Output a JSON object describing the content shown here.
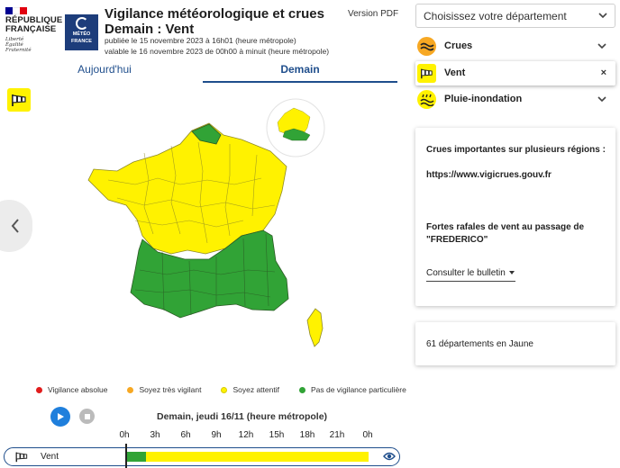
{
  "header": {
    "republique_line1": "RÉPUBLIQUE",
    "republique_line2": "FRANÇAISE",
    "motto": [
      "Liberté",
      "Égalité",
      "Fraternité"
    ],
    "meteo_logo_text": [
      "MÉTÉO",
      "FRANCE"
    ],
    "title_line1": "Vigilance météorologique et crues",
    "title_line2": "Demain : Vent",
    "published": "publiée le 15 novembre 2023 à 16h01 (heure métropole)",
    "valid": "valable le 16 novembre 2023 de 00h00 à minuit (heure métropole)",
    "pdf_link": "Version PDF"
  },
  "tabs": [
    {
      "label": "Aujourd'hui",
      "active": false
    },
    {
      "label": "Demain",
      "active": true
    }
  ],
  "legend": [
    {
      "label": "Vigilance absolue",
      "color": "#e11d1d"
    },
    {
      "label": "Soyez très vigilant",
      "color": "#f7a823"
    },
    {
      "label": "Soyez attentif",
      "color": "#fff200"
    },
    {
      "label": "Pas de vigilance particulière",
      "color": "#31a336"
    }
  ],
  "timeline": {
    "date_label": "Demain, jeudi 16/11 (heure métropole)",
    "hours": [
      "0h",
      "3h",
      "6h",
      "9h",
      "12h",
      "15h",
      "18h",
      "21h",
      "0h"
    ],
    "row_label": "Vent",
    "segments": [
      {
        "from_hour": 0,
        "to_hour": 2,
        "level_color": "#31a336"
      },
      {
        "from_hour": 2,
        "to_hour": 24,
        "level_color": "#fff200"
      }
    ]
  },
  "right_panel": {
    "department_select": "Choisissez votre département",
    "phenomena": [
      {
        "label": "Crues",
        "icon": "waves-icon",
        "color": "#f7a823",
        "action": "chevron-down",
        "selected": false
      },
      {
        "label": "Vent",
        "icon": "windsock-icon",
        "color": "#fff200",
        "action": "×",
        "selected": true
      },
      {
        "label": "Pluie-inondation",
        "icon": "rain-flood-icon",
        "color": "#fff200",
        "action": "chevron-down",
        "selected": false
      }
    ],
    "info_card": {
      "line1": "Crues importantes sur plusieurs régions :",
      "line2": "https://www.vigicrues.gouv.fr",
      "line3": "Fortes rafales de vent au passage de",
      "line4": "\"FREDERICO\"",
      "bulletin_link": "Consulter le bulletin"
    },
    "count_card": "61 départements en Jaune"
  },
  "colors": {
    "accent_blue": "#1f4e8c",
    "yellow": "#fff200",
    "green": "#31a336"
  }
}
